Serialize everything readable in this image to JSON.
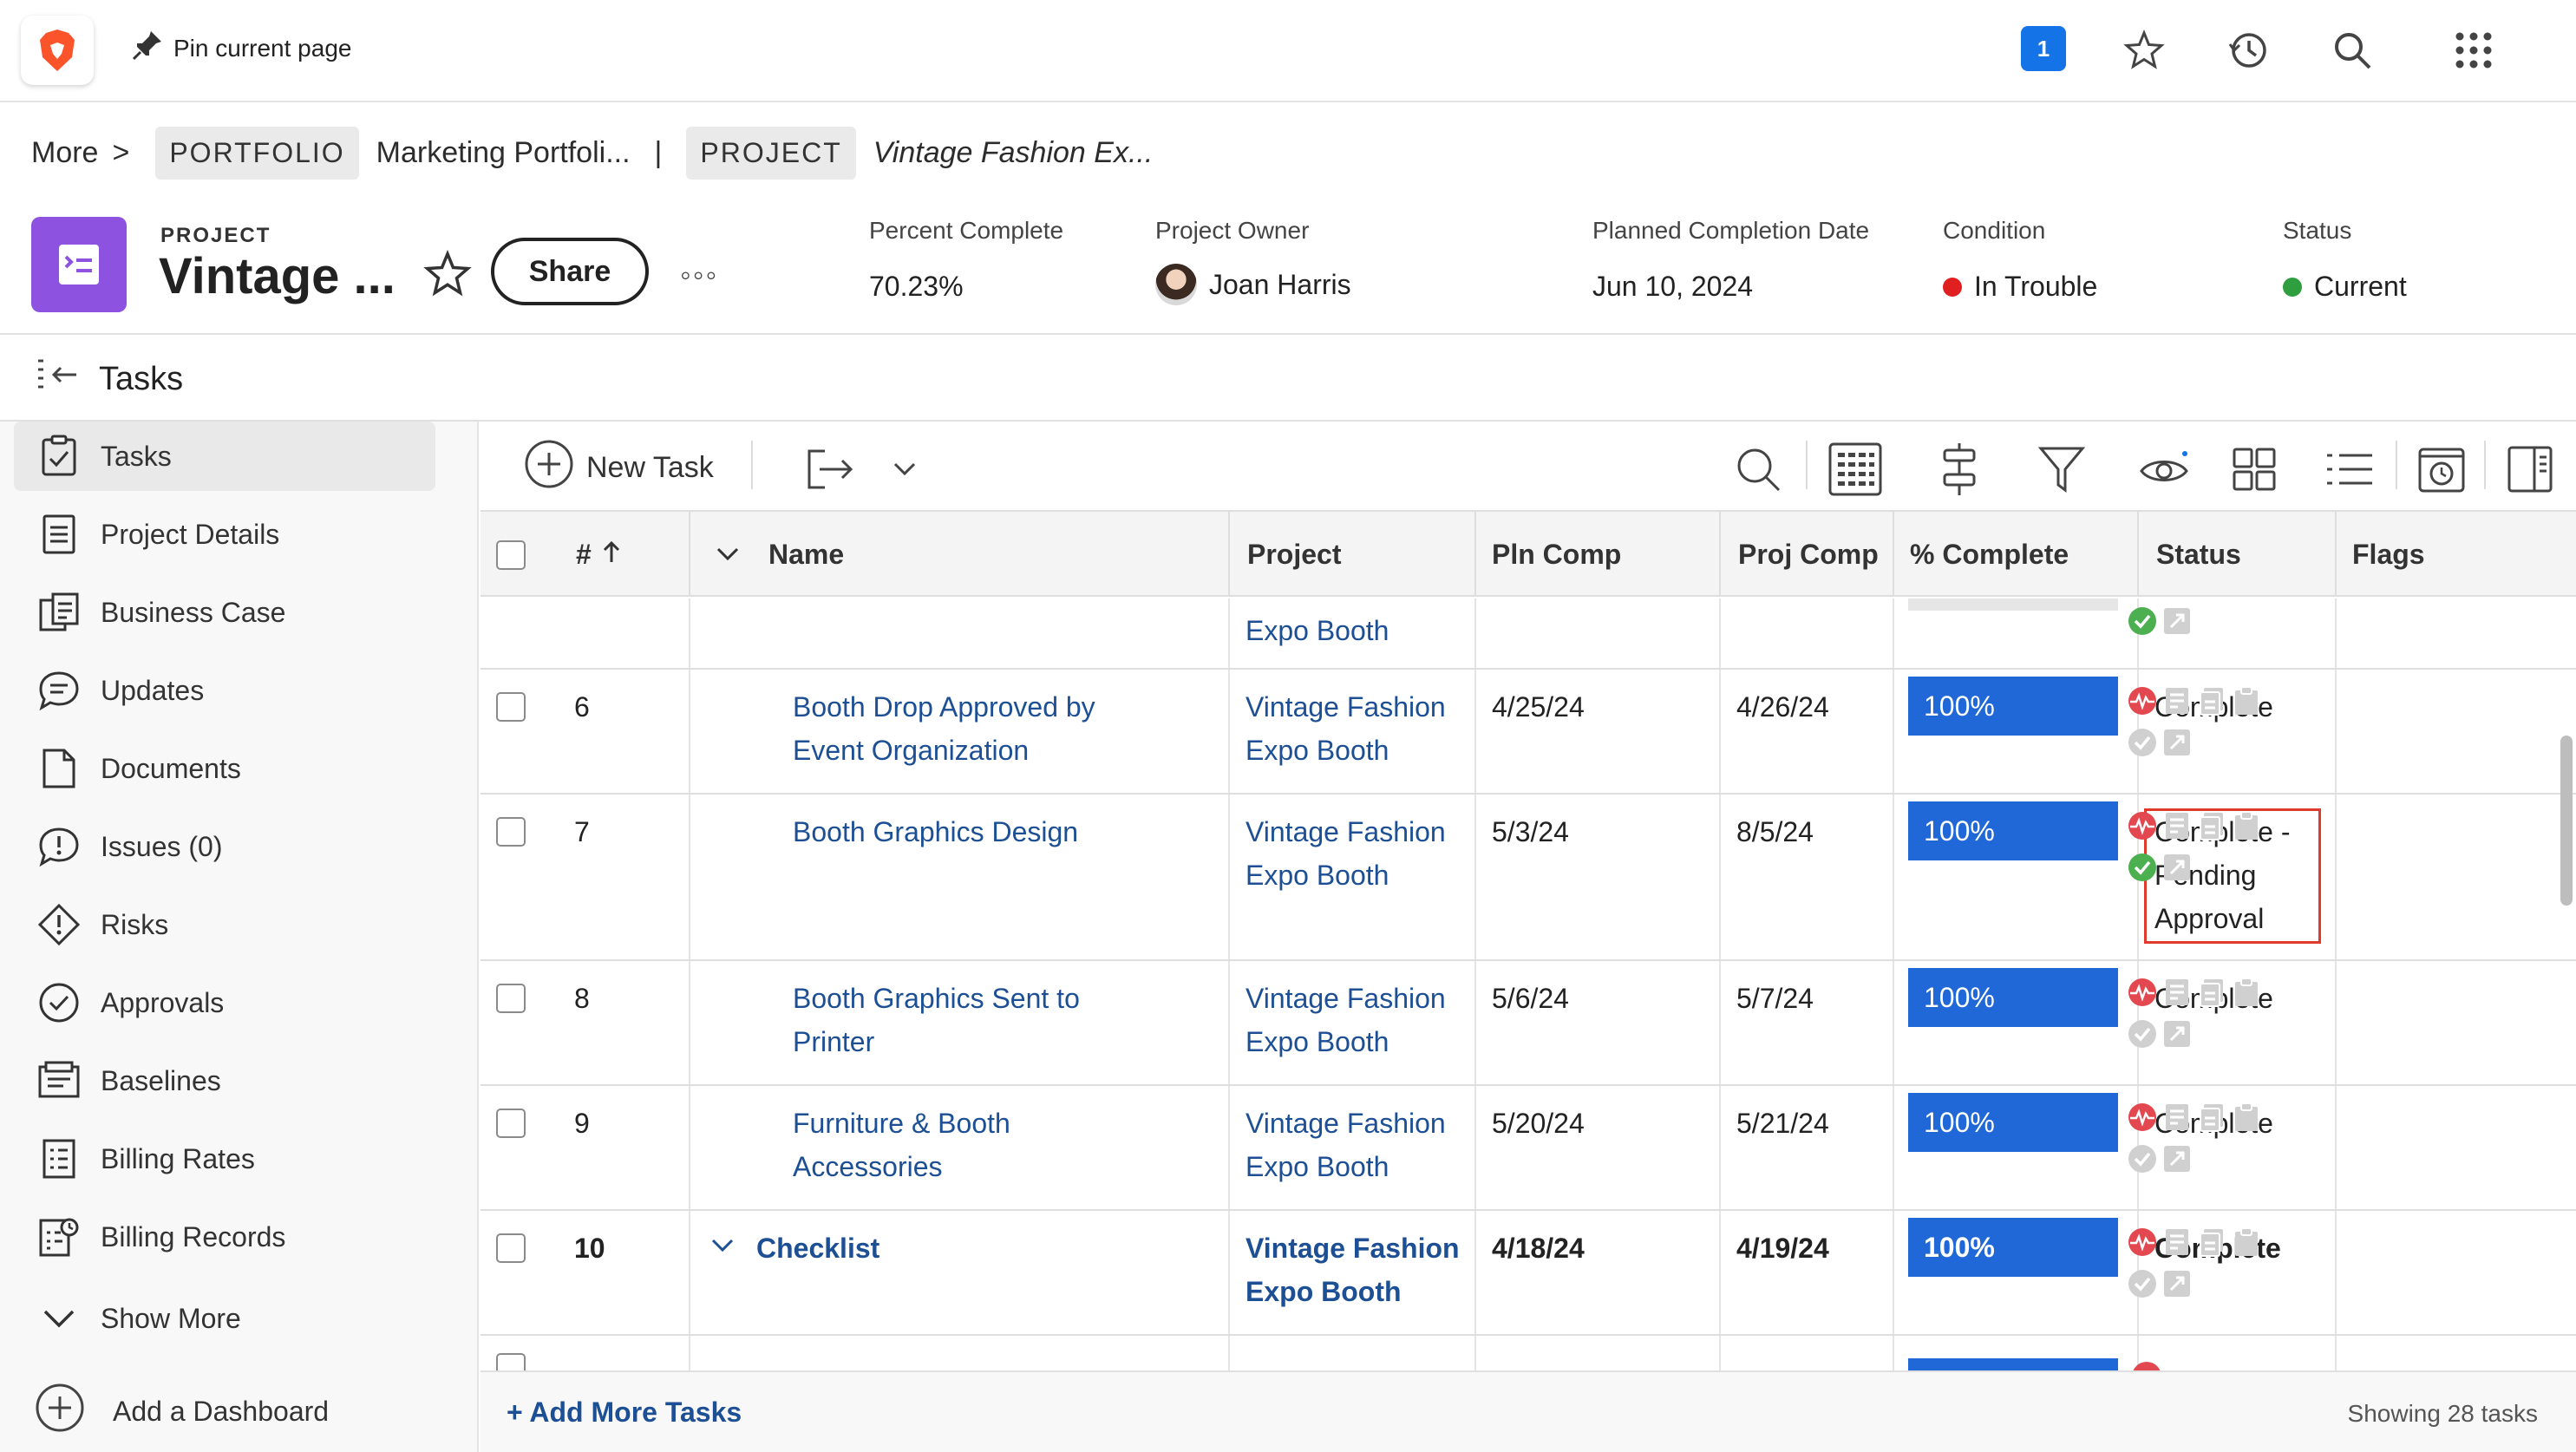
{
  "browser": {
    "pin_label": "Pin current page",
    "notification_count": "1"
  },
  "breadcrumb": {
    "more_label": "More",
    "more_sep": ">",
    "portfolio_tag": "PORTFOLIO",
    "portfolio_name": "Marketing Portfoli...",
    "divider": "|",
    "project_tag": "PROJECT",
    "project_name": "Vintage Fashion Ex..."
  },
  "project": {
    "kicker": "PROJECT",
    "title": "Vintage ...",
    "share_label": "Share",
    "more_label": "◦◦◦",
    "accent_color": "#8d52e0",
    "percent_complete_label": "Percent Complete",
    "percent_complete_value": "70.23%",
    "owner_label": "Project Owner",
    "owner_value": "Joan Harris",
    "planned_completion_label": "Planned Completion Date",
    "planned_completion_value": "Jun 10, 2024",
    "condition_label": "Condition",
    "condition_value": "In Trouble",
    "condition_color": "#e02020",
    "status_label": "Status",
    "status_value": "Current",
    "status_color": "#2e9e3e"
  },
  "section": {
    "title": "Tasks"
  },
  "sidebar": {
    "items": [
      {
        "label": "Tasks",
        "icon": "clipboard-check-icon"
      },
      {
        "label": "Project Details",
        "icon": "document-lines-icon"
      },
      {
        "label": "Business Case",
        "icon": "business-case-icon"
      },
      {
        "label": "Updates",
        "icon": "chat-bubble-icon"
      },
      {
        "label": "Documents",
        "icon": "document-icon"
      },
      {
        "label": "Issues (0)",
        "icon": "issue-bubble-icon"
      },
      {
        "label": "Risks",
        "icon": "risk-diamond-icon"
      },
      {
        "label": "Approvals",
        "icon": "approval-check-icon"
      },
      {
        "label": "Baselines",
        "icon": "baseline-icon"
      },
      {
        "label": "Billing Rates",
        "icon": "billing-rates-icon"
      },
      {
        "label": "Billing Records",
        "icon": "billing-records-icon"
      }
    ],
    "show_more_label": "Show More",
    "add_dashboard_label": "Add a Dashboard"
  },
  "toolbar": {
    "new_task_label": "New Task"
  },
  "table": {
    "headers": {
      "num": "#",
      "name": "Name",
      "project": "Project",
      "pln_comp": "Pln Comp",
      "proj_comp": "Proj Comp",
      "pct_complete": "% Complete",
      "status": "Status",
      "flags": "Flags"
    },
    "partial_top": {
      "project_line2": "Expo Booth"
    },
    "rows": [
      {
        "num": "6",
        "name1": "Booth Drop Approved by",
        "name2": "Event Organization",
        "project1": "Vintage Fashion",
        "project2": "Expo Booth",
        "pln": "4/25/24",
        "proj": "4/26/24",
        "pct": "100%",
        "status1": "Complete",
        "status2": "",
        "status3": "",
        "approved": "no"
      },
      {
        "num": "7",
        "name1": "Booth Graphics Design",
        "name2": "",
        "project1": "Vintage Fashion",
        "project2": "Expo Booth",
        "pln": "5/3/24",
        "proj": "8/5/24",
        "pct": "100%",
        "status1": "Complete -",
        "status2": "Pending",
        "status3": "Approval",
        "approved": "yes"
      },
      {
        "num": "8",
        "name1": "Booth Graphics Sent to",
        "name2": "Printer",
        "project1": "Vintage Fashion",
        "project2": "Expo Booth",
        "pln": "5/6/24",
        "proj": "5/7/24",
        "pct": "100%",
        "status1": "Complete",
        "status2": "",
        "status3": "",
        "approved": "no"
      },
      {
        "num": "9",
        "name1": "Furniture & Booth",
        "name2": "Accessories",
        "project1": "Vintage Fashion",
        "project2": "Expo Booth",
        "pln": "5/20/24",
        "proj": "5/21/24",
        "pct": "100%",
        "status1": "Complete",
        "status2": "",
        "status3": "",
        "approved": "no"
      },
      {
        "num": "10",
        "name1": "Checklist",
        "name2": "",
        "project1": "Vintage Fashion",
        "project2": "Expo Booth",
        "pln": "4/18/24",
        "proj": "4/19/24",
        "pct": "100%",
        "status1": "Complete",
        "status2": "",
        "status3": "",
        "approved": "no"
      }
    ]
  },
  "footer": {
    "add_more_label": "+ Add More Tasks",
    "showing_label": "Showing 28 tasks"
  }
}
